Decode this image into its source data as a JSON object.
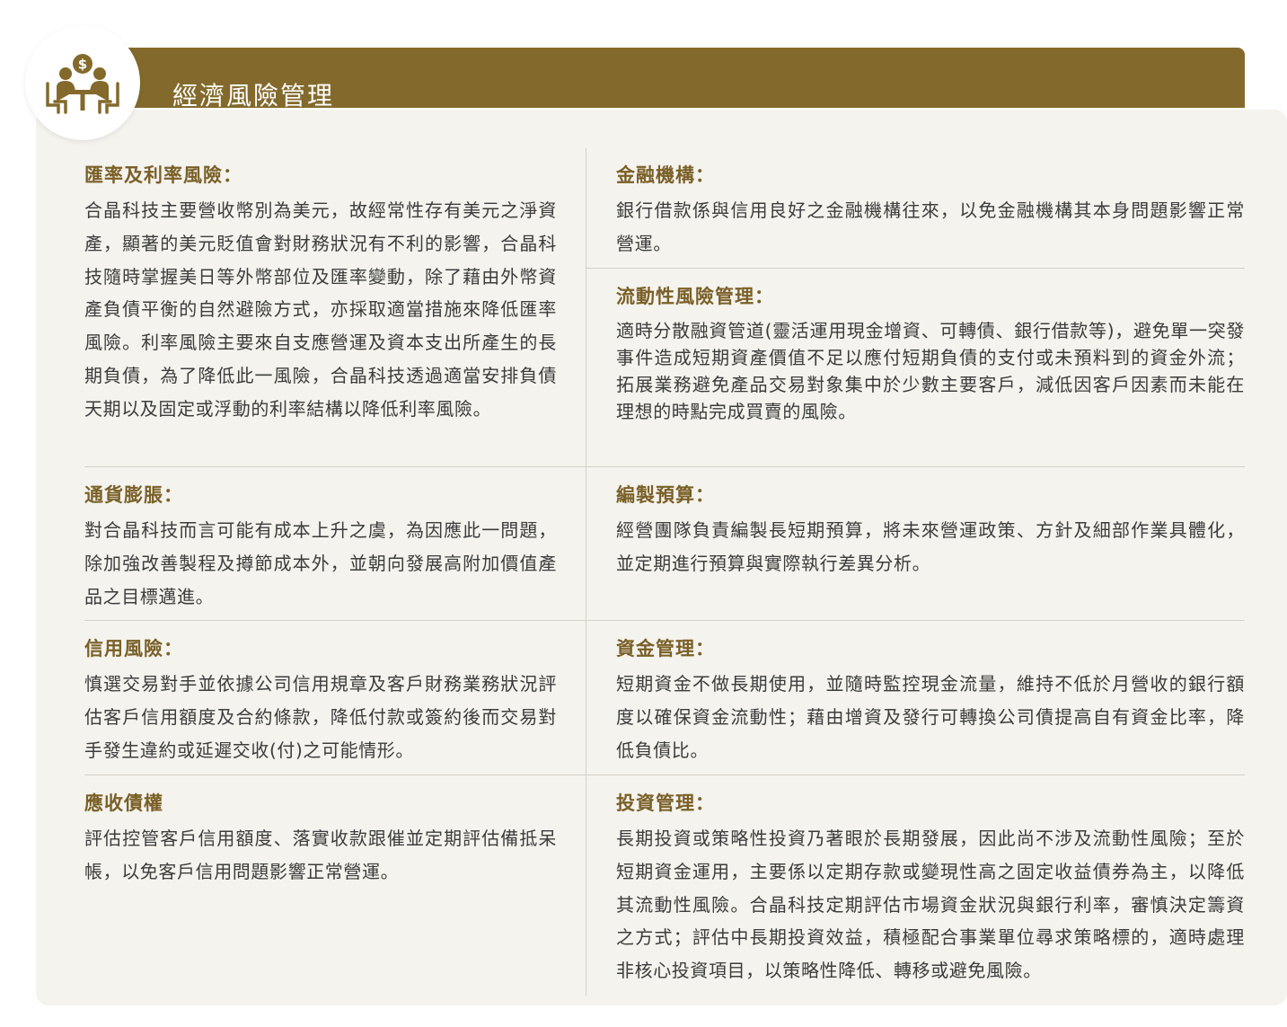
{
  "header": {
    "title": "經濟風險管理",
    "icon": "meeting-money-icon",
    "accent_color": "#836a2c"
  },
  "sections": {
    "exchange_rate": {
      "heading": "匯率及利率風險：",
      "body": "合晶科技主要營收幣別為美元，故經常性存有美元之淨資產，顯著的美元貶值會對財務狀況有不利的影響，合晶科技隨時掌握美日等外幣部位及匯率變動，除了藉由外幣資產負債平衡的自然避險方式，亦採取適當措施來降低匯率風險。利率風險主要來自支應營運及資本支出所產生的長期負債，為了降低此一風險，合晶科技透過適當安排負債天期以及固定或浮動的利率結構以降低利率風險。"
    },
    "financial_institution": {
      "heading": "金融機構：",
      "body": "銀行借款係與信用良好之金融機構往來，以免金融機構其本身問題影響正常營運。"
    },
    "liquidity": {
      "heading": "流動性風險管理：",
      "body": "適時分散融資管道(靈活運用現金增資、可轉債、銀行借款等)，避免單一突發事件造成短期資產價值不足以應付短期負債的支付或未預料到的資金外流；拓展業務避免產品交易對象集中於少數主要客戶，減低因客戶因素而未能在理想的時點完成買賣的風險。"
    },
    "inflation": {
      "heading": "通貨膨脹：",
      "body": "對合晶科技而言可能有成本上升之虞，為因應此一問題，除加強改善製程及撙節成本外，並朝向發展高附加價值產品之目標邁進。"
    },
    "budget": {
      "heading": "編製預算：",
      "body": "經營團隊負責編製長短期預算，將未來營運政策、方針及細部作業具體化，並定期進行預算與實際執行差異分析。"
    },
    "credit": {
      "heading": "信用風險：",
      "body": "慎選交易對手並依據公司信用規章及客戶財務業務狀況評估客戶信用額度及合約條款，降低付款或簽約後而交易對手發生違約或延遲交收(付)之可能情形。"
    },
    "fund_management": {
      "heading": "資金管理：",
      "body": "短期資金不做長期使用，並隨時監控現金流量，維持不低於月營收的銀行額度以確保資金流動性；藉由增資及發行可轉換公司債提高自有資金比率，降低負債比。"
    },
    "receivables": {
      "heading": "應收債權",
      "body": "評估控管客戶信用額度、落實收款跟催並定期評估備抵呆帳，以免客戶信用問題影響正常營運。"
    },
    "investment": {
      "heading": "投資管理：",
      "body": "長期投資或策略性投資乃著眼於長期發展，因此尚不涉及流動性風險；至於短期資金運用，主要係以定期存款或變現性高之固定收益債券為主，以降低其流動性風險。合晶科技定期評估市場資金狀況與銀行利率，審慎決定籌資之方式；評估中長期投資效益，積極配合事業單位尋求策略標的，適時處理非核心投資項目，以策略性降低、轉移或避免風險。"
    }
  }
}
